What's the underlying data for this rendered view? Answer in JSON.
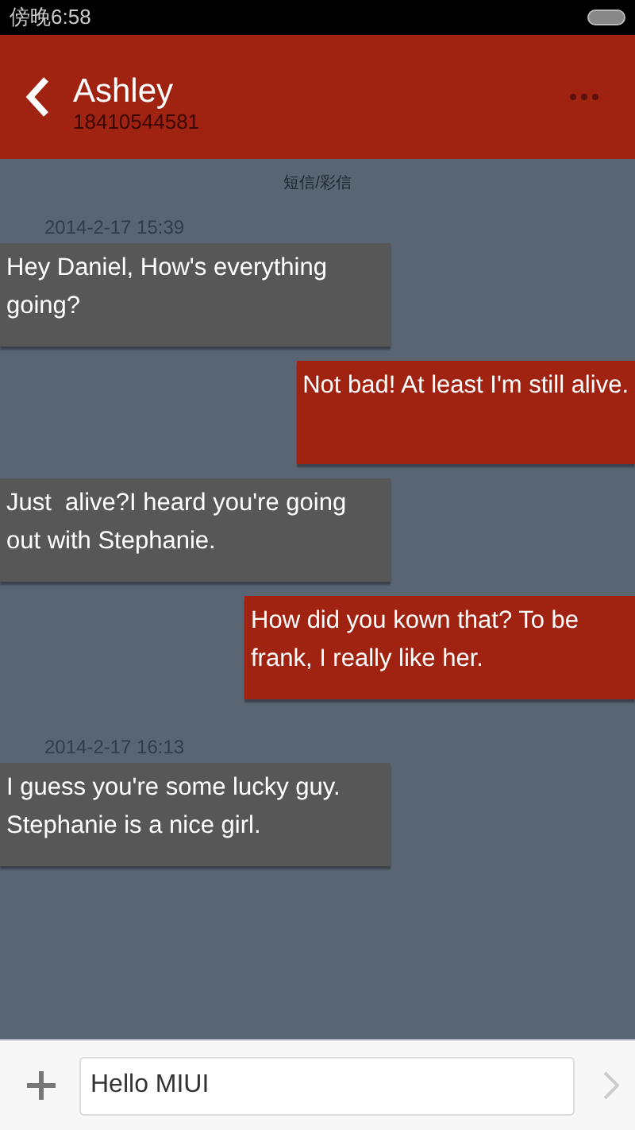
{
  "status_bar": {
    "time": "傍晚6:58"
  },
  "header": {
    "title": "Ashley",
    "subtitle": "18410544581"
  },
  "channel_label": "短信/彩信",
  "messages": [
    {
      "kind": "time",
      "text": "2014-2-17 15:39"
    },
    {
      "kind": "incoming",
      "text": "Hey Daniel, How's everything going?"
    },
    {
      "kind": "outgoing",
      "text": "Not bad! At least I'm still alive."
    },
    {
      "kind": "incoming",
      "text": "Just  alive?I heard you're going out with Stephanie."
    },
    {
      "kind": "outgoing",
      "text": "How did you kown that? To be frank, I really like her."
    },
    {
      "kind": "time",
      "text": "2014-2-17 16:13"
    },
    {
      "kind": "incoming",
      "text": "I guess you're some lucky guy. Stephanie is a nice girl."
    }
  ],
  "composer": {
    "value": "Hello MIUI"
  }
}
